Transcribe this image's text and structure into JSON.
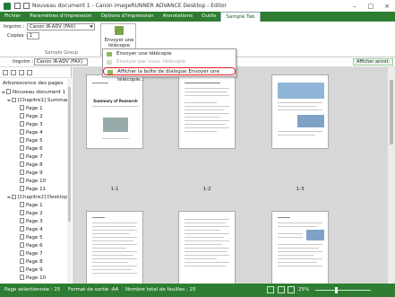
{
  "window": {
    "title": "Nouveau document 1 - Canon imageRUNNER ADVANCE Desktop - Editor"
  },
  "menu_tabs": [
    "Fichier",
    "Paramètres d'impression",
    "Options d'impression",
    "Annotations",
    "Outils",
    "Sample Tab"
  ],
  "ribbon": {
    "printer_label": "Imprim :",
    "printer_value": "Canon iR-ADV (FAX)",
    "copies_label": "Copies :",
    "copies_value": "1",
    "group_label": "Sample Group",
    "fax_button_label": "Envoyer une télécopie"
  },
  "toolbar2": {
    "printer_label": "Imprim :",
    "printer_value": "Canon iR-ADV (FAX)",
    "show_annotations": "Afficher annot."
  },
  "dropdown_menu": {
    "items": [
      {
        "label": "Envoyer une télécopie",
        "state": "normal"
      },
      {
        "label": "Envoyer par nouv. télécopie",
        "state": "disabled"
      },
      {
        "label": "Afficher la boîte de dialogue Envoyer une télécopie...",
        "state": "highlighted"
      }
    ]
  },
  "sidebar": {
    "tree_title": "Arborescence des pages",
    "tree": [
      {
        "label": "Nouveau document 1",
        "level": 0
      },
      {
        "label": "[Chapitre1] Summar",
        "level": 1
      },
      {
        "label": "Page 1",
        "level": 2
      },
      {
        "label": "Page 2",
        "level": 2
      },
      {
        "label": "Page 3",
        "level": 2
      },
      {
        "label": "Page 4",
        "level": 2
      },
      {
        "label": "Page 5",
        "level": 2
      },
      {
        "label": "Page 6",
        "level": 2
      },
      {
        "label": "Page 7",
        "level": 2
      },
      {
        "label": "Page 8",
        "level": 2
      },
      {
        "label": "Page 9",
        "level": 2
      },
      {
        "label": "Page 10",
        "level": 2
      },
      {
        "label": "Page 11",
        "level": 2
      },
      {
        "label": "[Chapitre2] Desktop",
        "level": 1
      },
      {
        "label": "Page 1",
        "level": 2
      },
      {
        "label": "Page 2",
        "level": 2
      },
      {
        "label": "Page 3",
        "level": 2
      },
      {
        "label": "Page 4",
        "level": 2
      },
      {
        "label": "Page 5",
        "level": 2
      },
      {
        "label": "Page 6",
        "level": 2
      },
      {
        "label": "Page 7",
        "level": 2
      },
      {
        "label": "Page 8",
        "level": 2
      },
      {
        "label": "Page 9",
        "level": 2
      },
      {
        "label": "Page 10",
        "level": 2
      }
    ]
  },
  "pages": [
    {
      "label": "1-1",
      "heading": "Summary of Research"
    },
    {
      "label": "1-2",
      "heading": ""
    },
    {
      "label": "1-3",
      "heading": ""
    },
    {
      "label": "",
      "heading": ""
    },
    {
      "label": "",
      "heading": ""
    },
    {
      "label": "",
      "heading": ""
    }
  ],
  "status": {
    "selected_pages": "Page sélectionnée : 25",
    "output_format": "Format de sortie :A4",
    "sheet_count": "Nombre total de feuilles : 25",
    "zoom": "25%"
  },
  "colors": {
    "accent": "#2e7d32",
    "highlight_ring": "#e02020"
  }
}
